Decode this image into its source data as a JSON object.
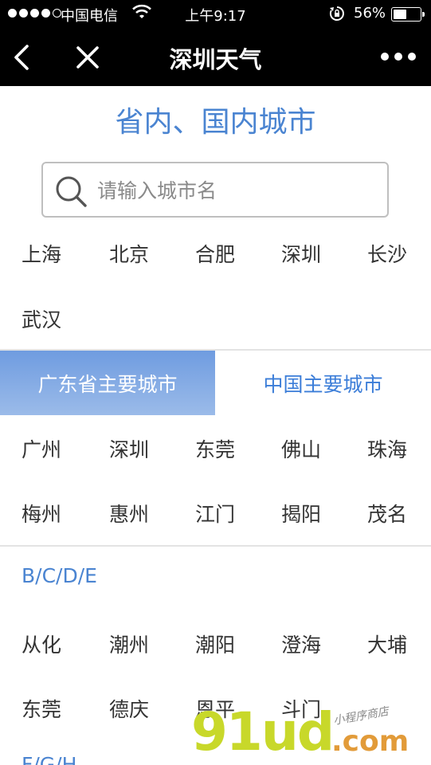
{
  "status_bar": {
    "carrier": "中国电信",
    "time": "上午9:17",
    "battery_percent": "56%",
    "battery_level": 0.56,
    "signal_icon": "signal-dots-icon",
    "wifi_icon": "wifi-icon",
    "rotation_lock_icon": "rotation-lock-icon",
    "battery_icon": "battery-icon"
  },
  "navbar": {
    "title": "深圳天气",
    "back_icon": "back-chevron-icon",
    "close_icon": "close-icon",
    "more_icon": "more-dots-icon"
  },
  "section_title": "省内、国内城市",
  "search": {
    "placeholder": "请输入城市名",
    "icon": "search-icon"
  },
  "hot_cities": [
    "上海",
    "北京",
    "合肥",
    "深圳",
    "长沙",
    "武汉"
  ],
  "tabs": [
    {
      "label": "广东省主要城市",
      "active": true
    },
    {
      "label": "中国主要城市",
      "active": false
    }
  ],
  "province_cities": [
    "广州",
    "深圳",
    "东莞",
    "佛山",
    "珠海",
    "梅州",
    "惠州",
    "江门",
    "揭阳",
    "茂名"
  ],
  "letter_group": {
    "heading": "B/C/D/E",
    "cities": [
      "从化",
      "潮州",
      "潮阳",
      "澄海",
      "大埔",
      "东莞",
      "德庆",
      "恩平",
      "斗门"
    ]
  },
  "next_letter_group_heading": "F/G/H",
  "watermark": {
    "main": "91ud",
    "domain": ".com",
    "sub": "小程序商店"
  },
  "colors": {
    "accent": "#4a84d1",
    "tab_active_bg": "#7fa6e3",
    "nav_bg": "#000000",
    "watermark_green": "#c8d82a",
    "watermark_orange": "#e29b39"
  }
}
